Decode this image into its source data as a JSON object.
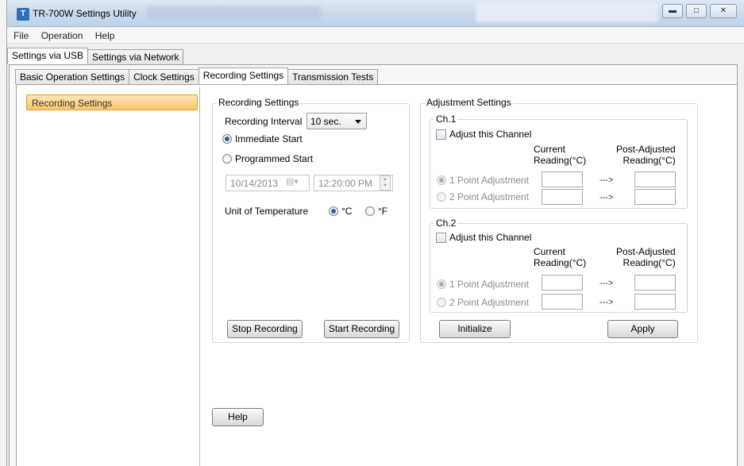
{
  "window": {
    "title": "TR-700W Settings Utility"
  },
  "menu": [
    "File",
    "Operation",
    "Help"
  ],
  "outer_tabs": [
    {
      "label": "Settings via USB",
      "active": true
    },
    {
      "label": "Settings via Network",
      "active": false
    }
  ],
  "inner_tabs": [
    {
      "label": "Basic Operation Settings",
      "active": false
    },
    {
      "label": "Clock Settings",
      "active": false
    },
    {
      "label": "Recording Settings",
      "active": true
    },
    {
      "label": "Transmission Tests",
      "active": false
    }
  ],
  "sidebar": {
    "items": [
      {
        "label": "Recording Settings",
        "selected": true
      }
    ]
  },
  "recording": {
    "group_title": "Recording Settings",
    "interval_label": "Recording Interval",
    "interval_value": "10 sec.",
    "immediate_start": "Immediate Start",
    "programmed_start": "Programmed Start",
    "date_value": "10/14/2013",
    "time_value": "12:20:00 PM",
    "unit_label": "Unit of Temperature",
    "unit_c": "°C",
    "unit_f": "°F",
    "stop_button": "Stop Recording",
    "start_button": "Start Recording"
  },
  "adjustment": {
    "group_title": "Adjustment Settings",
    "channels": [
      {
        "title": "Ch.1",
        "adjust_label": "Adjust this Channel",
        "current_header": "Current\nReading(°C)",
        "post_header": "Post-Adjusted\nReading(°C)",
        "one_point": "1 Point Adjustment",
        "two_point": "2 Point Adjustment",
        "arrow": "--->"
      },
      {
        "title": "Ch.2",
        "adjust_label": "Adjust this Channel",
        "current_header": "Current\nReading(°C)",
        "post_header": "Post-Adjusted\nReading(°C)",
        "one_point": "1 Point Adjustment",
        "two_point": "2 Point Adjustment",
        "arrow": "--->"
      }
    ],
    "initialize_button": "Initialize",
    "apply_button": "Apply"
  },
  "help_button": "Help",
  "colors": {
    "selected_item": "#f8c66b",
    "radio_selected": "#2b5fa8"
  }
}
